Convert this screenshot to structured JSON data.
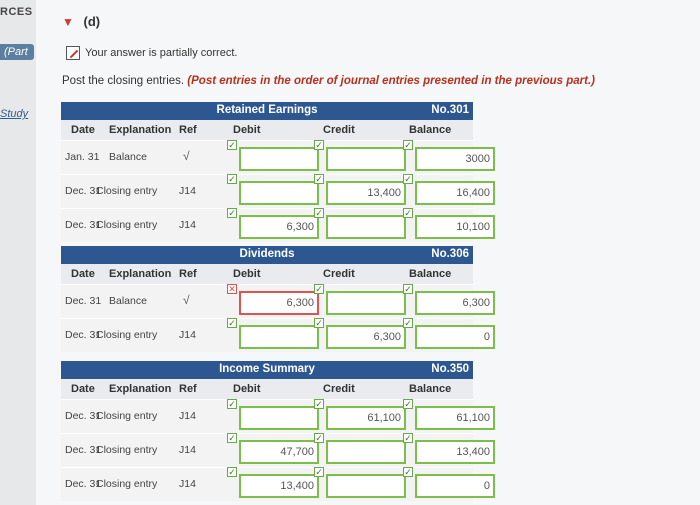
{
  "sidebar": {
    "sources": "RCES",
    "part": "(Part",
    "study": "Study"
  },
  "section": {
    "label": "(d)",
    "status_text": "Your answer is partially correct.",
    "instructions_plain": "Post the closing entries.",
    "instructions_emph": "(Post entries in the order of journal entries presented in the previous part.)"
  },
  "columns": {
    "date": "Date",
    "explanation": "Explanation",
    "ref": "Ref",
    "debit": "Debit",
    "credit": "Credit",
    "balance": "Balance"
  },
  "ledgers": [
    {
      "account": "Retained Earnings",
      "number": "No.301",
      "rows": [
        {
          "date": "Jan. 31",
          "explanation": "Balance",
          "ref": "√",
          "debit": "",
          "credit": "",
          "balance": "3000"
        },
        {
          "date": "Dec. 31",
          "explanation": "Closing entry",
          "ref": "J14",
          "debit": "",
          "credit": "13,400",
          "balance": "16,400"
        },
        {
          "date": "Dec. 31",
          "explanation": "Closing entry",
          "ref": "J14",
          "debit": "6,300",
          "credit": "",
          "balance": "10,100"
        }
      ]
    },
    {
      "account": "Dividends",
      "number": "No.306",
      "rows": [
        {
          "date": "Dec. 31",
          "explanation": "Balance",
          "ref": "√",
          "debit": "6,300",
          "credit": "",
          "balance": "6,300",
          "debit_wrong": true
        },
        {
          "date": "Dec. 31",
          "explanation": "Closing entry",
          "ref": "J14",
          "debit": "",
          "credit": "6,300",
          "balance": "0"
        }
      ]
    },
    {
      "account": "Income Summary",
      "number": "No.350",
      "rows": [
        {
          "date": "Dec. 31",
          "explanation": "Closing entry",
          "ref": "J14",
          "debit": "",
          "credit": "61,100",
          "balance": "61,100"
        },
        {
          "date": "Dec. 31",
          "explanation": "Closing entry",
          "ref": "J14",
          "debit": "47,700",
          "credit": "",
          "balance": "13,400"
        },
        {
          "date": "Dec. 31",
          "explanation": "Closing entry",
          "ref": "J14",
          "debit": "13,400",
          "credit": "",
          "balance": "0"
        }
      ]
    }
  ],
  "colors": {
    "header_blue": "#2d5791",
    "correct_green": "#7bbf4a",
    "wrong_red": "#e05353",
    "accent_red": "#b7311f"
  }
}
